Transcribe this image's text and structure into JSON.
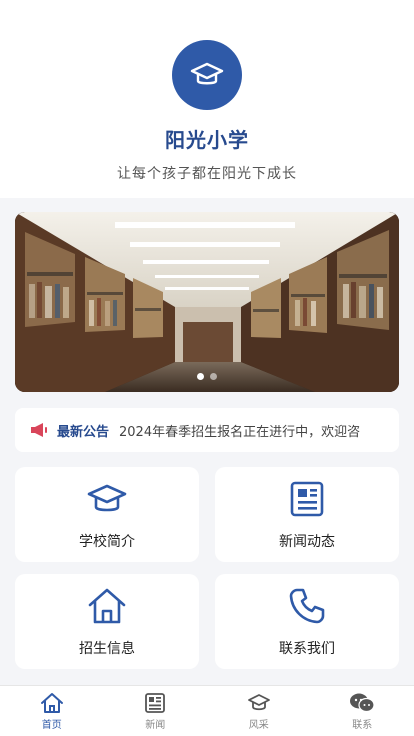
{
  "header": {
    "school_name": "阳光小学",
    "slogan": "让每个孩子都在阳光下成长",
    "logo_icon": "graduation-cap-icon"
  },
  "banner": {
    "image": "library-bookshelves",
    "slide_count": 2,
    "active_slide": 1
  },
  "notice": {
    "icon": "megaphone-icon",
    "title": "最新公告",
    "text": "2024年春季招生报名正在进行中，欢迎咨"
  },
  "menu": [
    {
      "label": "学校简介",
      "icon": "graduation-cap-icon"
    },
    {
      "label": "新闻动态",
      "icon": "newspaper-icon"
    },
    {
      "label": "招生信息",
      "icon": "home-icon"
    },
    {
      "label": "联系我们",
      "icon": "phone-icon"
    }
  ],
  "tabbar": [
    {
      "label": "首页",
      "icon": "home-icon",
      "active": true
    },
    {
      "label": "新闻",
      "icon": "newspaper-icon",
      "active": false
    },
    {
      "label": "风采",
      "icon": "graduation-cap-icon",
      "active": false
    },
    {
      "label": "联系",
      "icon": "chat-icon",
      "active": false
    }
  ],
  "colors": {
    "primary": "#2f5aa8",
    "title": "#274a8e",
    "background": "#f4f5f8",
    "inactive_tab": "#888888"
  }
}
